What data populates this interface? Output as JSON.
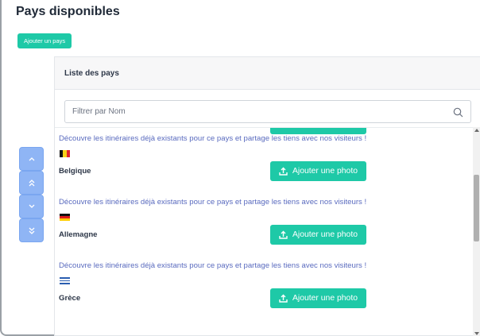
{
  "page": {
    "title": "Pays disponibles",
    "add_button_label": "Ajouter un pays"
  },
  "scroll_controls": [
    {
      "name": "scroll-up-button",
      "glyph": "⌃",
      "icon": "chevron-up-icon"
    },
    {
      "name": "scroll-top-button",
      "glyph": "≈",
      "icon": "double-chevron-up-icon"
    },
    {
      "name": "scroll-down-button",
      "glyph": "⌄",
      "icon": "chevron-down-icon"
    },
    {
      "name": "scroll-bottom-button",
      "glyph": "»",
      "icon": "double-chevron-down-icon"
    }
  ],
  "card": {
    "title": "Liste des pays",
    "filter": {
      "placeholder": "Filtrer par Nom",
      "value": ""
    }
  },
  "countries": [
    {
      "link_text": "Découvre les itinéraires déjà existants pour ce pays et partage les tiens avec nos visiteurs !",
      "name": "Belgique",
      "flag": "belgium-flag",
      "photo_button_label": "Ajouter une photo"
    },
    {
      "link_text": "Découvre les itinéraires déjà existants pour ce pays et partage les tiens avec nos visiteurs !",
      "name": "Allemagne",
      "flag": "germany-flag",
      "photo_button_label": "Ajouter une photo"
    },
    {
      "link_text": "Découvre les itinéraires déjà existants pour ce pays et partage les tiens avec nos visiteurs !",
      "name": "Grèce",
      "flag": "greece-flag",
      "photo_button_label": "Ajouter une photo"
    }
  ],
  "colors": {
    "accent": "#1ec9a7",
    "link": "#5a6bbf",
    "scroll_button": "#8fb5f5"
  }
}
